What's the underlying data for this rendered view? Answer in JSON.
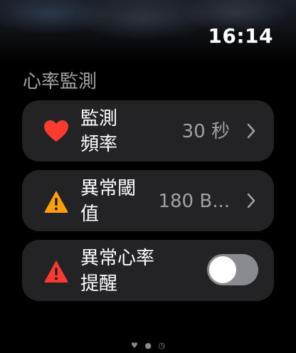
{
  "status": {
    "time": "16:14"
  },
  "section": {
    "title": "心率監測"
  },
  "rows": [
    {
      "label_line1": "監測",
      "label_line2": "頻率",
      "value": "30 秒",
      "icon": "heart-icon",
      "icon_color": "#ff3b30"
    },
    {
      "label_line1": "異常閾",
      "label_line2": "值",
      "value": "180 B...",
      "icon": "warning-icon",
      "icon_color": "#ff9f0a"
    },
    {
      "label_line1": "異常心率",
      "label_line2": "提醒",
      "toggle_on": false,
      "icon": "warning-icon",
      "icon_color": "#ff3b30"
    }
  ],
  "pager": {
    "icons": [
      "heart-icon",
      "person-icon",
      "gauge-icon"
    ]
  }
}
